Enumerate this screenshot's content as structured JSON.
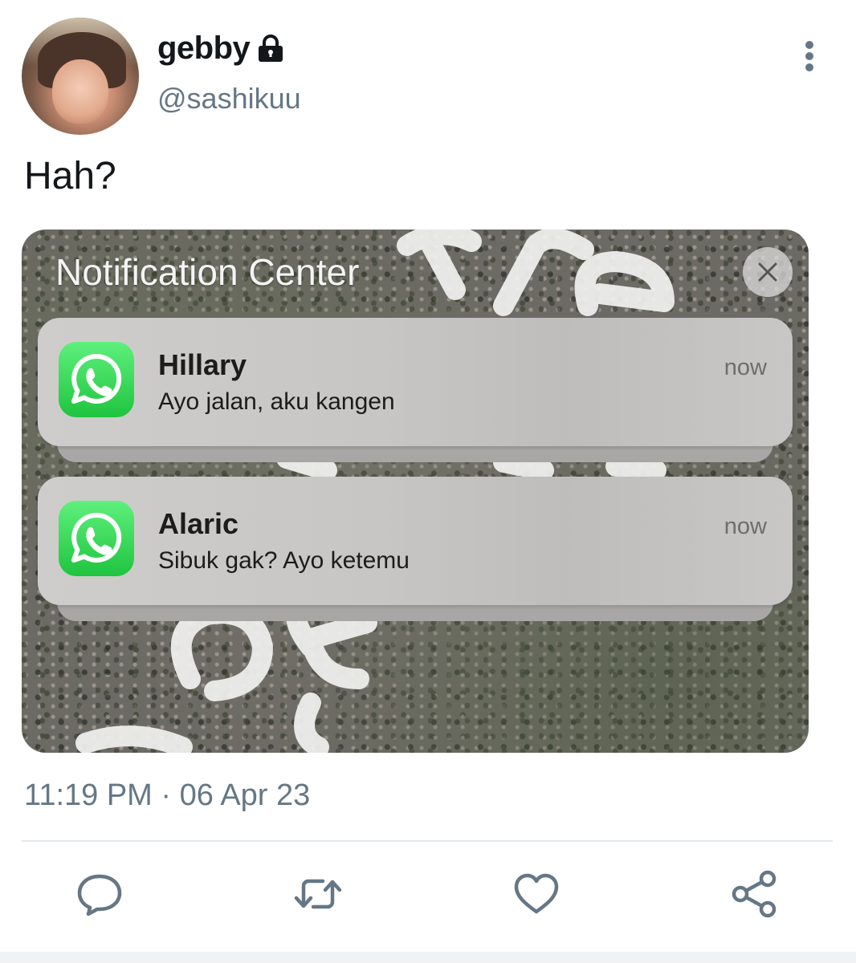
{
  "header": {
    "display_name": "gebby",
    "handle": "@sashikuu",
    "icons": {
      "lock": "lock-icon",
      "more": "more-vertical-icon"
    }
  },
  "tweet": {
    "text": "Hah?",
    "timestamp": "11:19 PM · 06 Apr 23"
  },
  "media": {
    "title": "Notification Center",
    "notifications": [
      {
        "app_icon": "whatsapp-icon",
        "sender": "Hillary",
        "message": "Ayo jalan, aku kangen",
        "time": "now"
      },
      {
        "app_icon": "whatsapp-icon",
        "sender": "Alaric",
        "message": "Sibuk gak? Ayo ketemu",
        "time": "now"
      }
    ]
  },
  "actions": [
    {
      "name": "reply",
      "icon": "comment-icon"
    },
    {
      "name": "retweet",
      "icon": "retweet-icon"
    },
    {
      "name": "like",
      "icon": "heart-icon"
    },
    {
      "name": "share",
      "icon": "share-icon"
    }
  ],
  "colors": {
    "secondary_text": "#657786",
    "whatsapp_green": "#25d366",
    "divider": "#e1e8ed"
  }
}
